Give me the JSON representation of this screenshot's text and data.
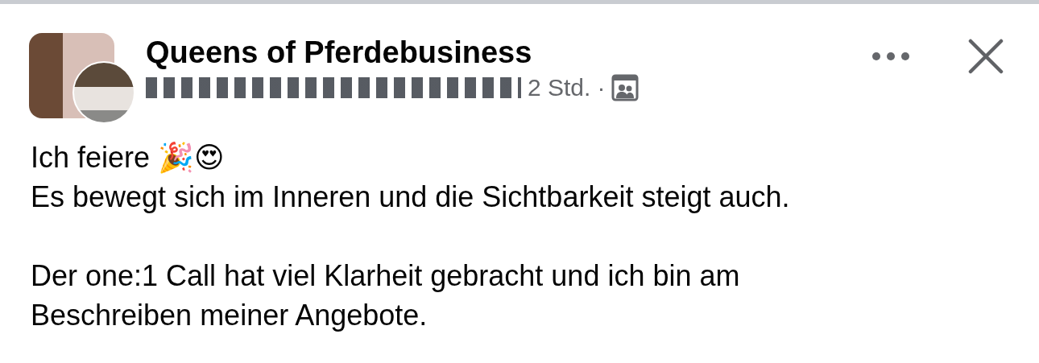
{
  "post": {
    "page_name": "Queens of Pferdebusiness",
    "time": "2 Std.",
    "separator": "·",
    "paragraphs": [
      {
        "lines": [
          "Ich feiere 🎉😍",
          "Es bewegt sich im Inneren und die Sichtbarkeit steigt auch."
        ]
      },
      {
        "lines": [
          "Der one:1 Call hat viel Klarheit gebracht und ich bin am",
          "Beschreiben meiner Angebote."
        ]
      }
    ]
  }
}
